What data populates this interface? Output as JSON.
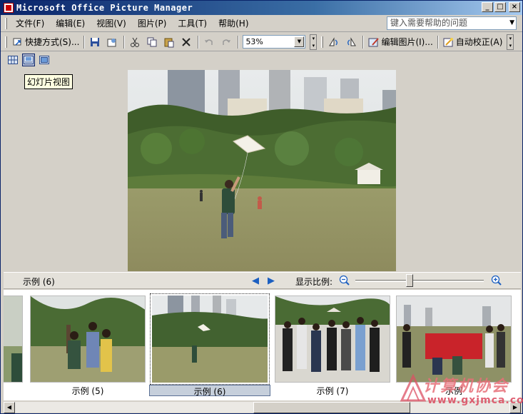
{
  "window": {
    "title": "Microsoft Office Picture Manager",
    "minimize_glyph": "_",
    "maximize_glyph": "□",
    "close_glyph": "×"
  },
  "menu": {
    "items": [
      {
        "label": "文件(F)"
      },
      {
        "label": "编辑(E)"
      },
      {
        "label": "视图(V)"
      },
      {
        "label": "图片(P)"
      },
      {
        "label": "工具(T)"
      },
      {
        "label": "帮助(H)"
      }
    ],
    "help_placeholder": "键入需要帮助的问题"
  },
  "toolbar": {
    "shortcuts_label": "快捷方式(S)...",
    "zoom_value": "53%",
    "edit_picture_label": "编辑图片(I)...",
    "auto_correct_label": "自动校正(A)",
    "icons": [
      "save-icon",
      "upload-icon",
      "cut-icon",
      "copy-icon",
      "paste-icon",
      "delete-icon",
      "undo-icon",
      "redo-icon",
      "rotate-left-icon",
      "rotate-right-icon"
    ]
  },
  "view": {
    "tooltip": "幻灯片视图",
    "modes": [
      "thumbnail-view-icon",
      "filmstrip-view-icon",
      "single-view-icon"
    ]
  },
  "strip": {
    "current_name": "示例 (6)",
    "zoom_label": "显示比例:",
    "zoom_level": 0.42
  },
  "thumbnails": [
    {
      "label": ""
    },
    {
      "label": "示例 (5)"
    },
    {
      "label": "示例 (6)",
      "selected": true
    },
    {
      "label": "示例 (7)"
    },
    {
      "label": "示例"
    }
  ],
  "watermark": {
    "text": "计算机协会",
    "url": "www.gxjmca.com"
  },
  "colors": {
    "titlebar": "#0a246a",
    "chrome": "#d4d0c8",
    "selection": "#c6cfdb"
  }
}
